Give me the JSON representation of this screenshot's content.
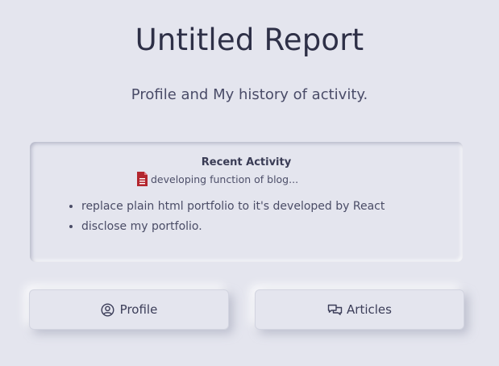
{
  "page": {
    "title": "Untitled Report",
    "subtitle": "Profile and My history of activity."
  },
  "activity": {
    "heading": "Recent Activity",
    "document": {
      "icon": "document-icon",
      "text": "developing function of blog..."
    },
    "items": [
      "replace plain html portfolio to it's developed by React",
      "disclose my portfolio."
    ]
  },
  "buttons": {
    "profile": {
      "label": "Profile",
      "icon": "user-circle-icon"
    },
    "articles": {
      "label": "Articles",
      "icon": "chat-bubbles-icon"
    }
  },
  "colors": {
    "background": "#e4e5ee",
    "text": "#3b3d58",
    "document_icon": "#b3262e"
  }
}
